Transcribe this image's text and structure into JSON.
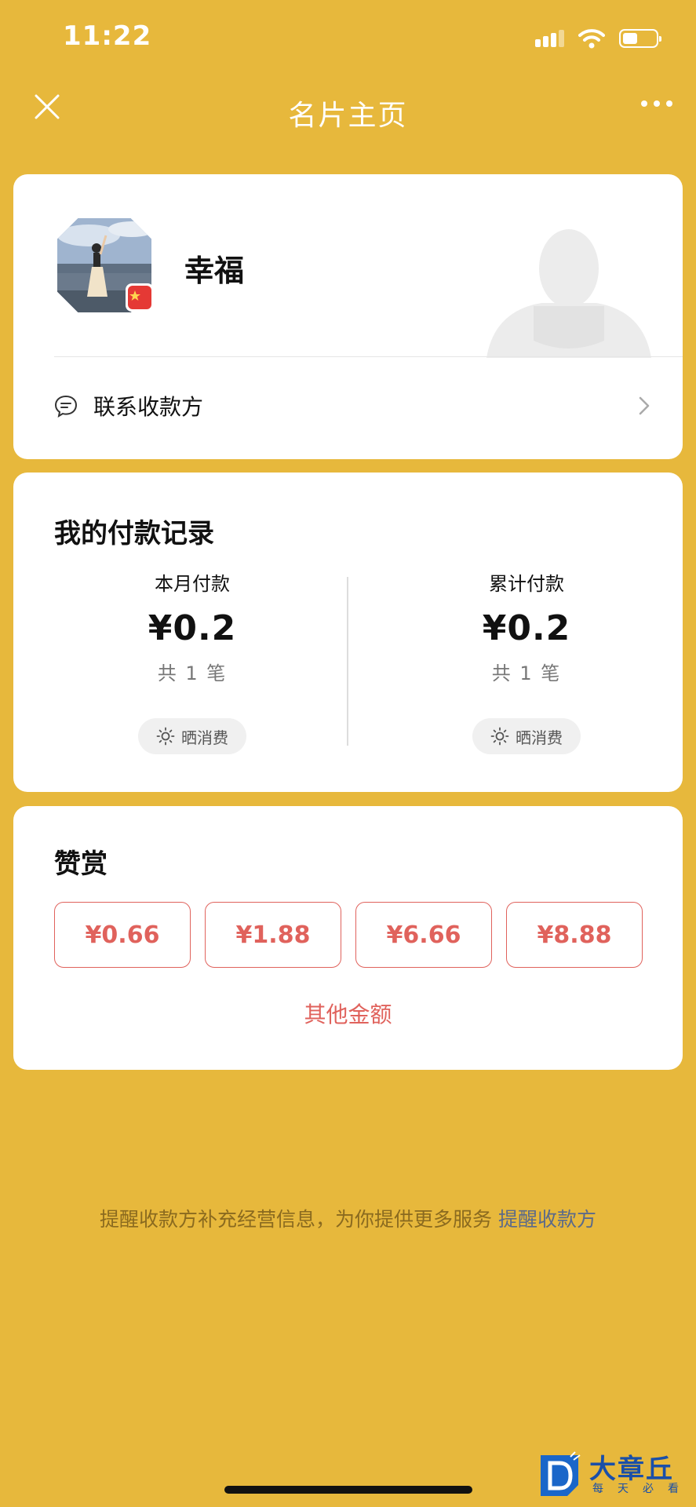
{
  "status_bar": {
    "time": "11:22"
  },
  "nav": {
    "title": "名片主页"
  },
  "profile": {
    "name": "幸福",
    "contact_label": "联系收款方"
  },
  "payment_records": {
    "title": "我的付款记录",
    "this_month": {
      "label": "本月付款",
      "amount": "¥0.2",
      "count": "共 1 笔",
      "share_label": "晒消费"
    },
    "total": {
      "label": "累计付款",
      "amount": "¥0.2",
      "count": "共 1 笔",
      "share_label": "晒消费"
    }
  },
  "reward": {
    "title": "赞赏",
    "options": [
      "¥0.66",
      "¥1.88",
      "¥6.66",
      "¥8.88"
    ],
    "other_label": "其他金额"
  },
  "reminder": {
    "text": "提醒收款方补充经营信息，为你提供更多服务",
    "link": "提醒收款方"
  },
  "watermark": {
    "brand": "大章丘",
    "sub": "每天必看"
  },
  "colors": {
    "background": "#E7B83C",
    "accent_red": "#E0625C"
  },
  "icons": [
    "close-icon",
    "more-icon",
    "chat-bubble-icon",
    "chevron-right-icon",
    "sun-icon",
    "china-flag-icon"
  ]
}
